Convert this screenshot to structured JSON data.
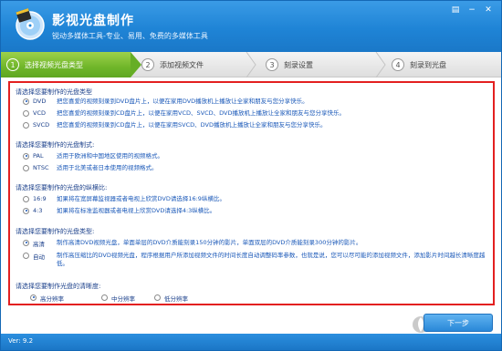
{
  "app": {
    "title": "影视光盘制作",
    "subtitle": "锐动多媒体工具-专业、易用、免费的多媒体工具"
  },
  "window_controls": [
    {
      "name": "menu-icon",
      "glyph": "▤"
    },
    {
      "name": "minimize-icon",
      "glyph": "−"
    },
    {
      "name": "close-icon",
      "glyph": "✕"
    }
  ],
  "steps": [
    {
      "num": "1",
      "label": "选择视频光盘类型",
      "active": true
    },
    {
      "num": "2",
      "label": "添加视频文件",
      "active": false
    },
    {
      "num": "3",
      "label": "刻录设置",
      "active": false
    },
    {
      "num": "4",
      "label": "刻录到光盘",
      "active": false
    }
  ],
  "sections": {
    "disc_type": {
      "title": "请选择您要制作的光盘类型",
      "options": [
        {
          "name": "DVD",
          "desc": "把您喜爱的视频刻录到DVD盘片上，以便在家用DVD播放机上播放让全家和朋友与您分享快乐。",
          "checked": true
        },
        {
          "name": "VCD",
          "desc": "把您喜爱的视频刻录到CD盘片上，以便在家用VCD、SVCD、DVD播放机上播放让全家和朋友与您分享快乐。",
          "checked": false
        },
        {
          "name": "SVCD",
          "desc": "把您喜爱的视频刻录到CD盘片上，以便在家用SVCD、DVD播放机上播放让全家和朋友与您分享快乐。",
          "checked": false
        }
      ]
    },
    "tv_system": {
      "title": "请选择您要制作的光盘制式:",
      "options": [
        {
          "name": "PAL",
          "desc": "适用于欧洲和中国地区使用的视频格式。",
          "checked": true
        },
        {
          "name": "NTSC",
          "desc": "适用于北美或者日本使用的视频格式。",
          "checked": false
        }
      ]
    },
    "aspect": {
      "title": "请选择您要制作的光盘的纵横比:",
      "options": [
        {
          "name": "16:9",
          "desc": "如果将在宽屏幕监视器或者电视上欣赏DVD请选择16:9纵横比。",
          "checked": false
        },
        {
          "name": "4:3",
          "desc": "如果将在标准监视器或者电视上欣赏DVD请选择4:3纵横比。",
          "checked": true
        }
      ]
    },
    "quality_type": {
      "title": "请选择您要制作的光盘类型:",
      "options": [
        {
          "name": "高清",
          "desc": "制作高清DVD视频光盘，单面单层的DVD介质能刻录150分钟的影片，单面双层的DVD介质能刻录300分钟的影片。",
          "checked": true
        },
        {
          "name": "自动",
          "desc": "制作高压缩比的DVD视频光盘，程序根据用户所添加视频文件的时间长度自动调整码率参数，也就是说，您可以尽可能的添加视频文件，添加影片时间越长清晰度越低。",
          "checked": false
        }
      ]
    },
    "resolution": {
      "title": "请选择您要制作光盘的清晰度:",
      "options": [
        {
          "name": "高分辨率",
          "checked": true
        },
        {
          "name": "中分辨率",
          "checked": false
        },
        {
          "name": "低分辨率",
          "checked": false
        }
      ]
    }
  },
  "next_button": "下一步",
  "version": "Ver: 9.2"
}
